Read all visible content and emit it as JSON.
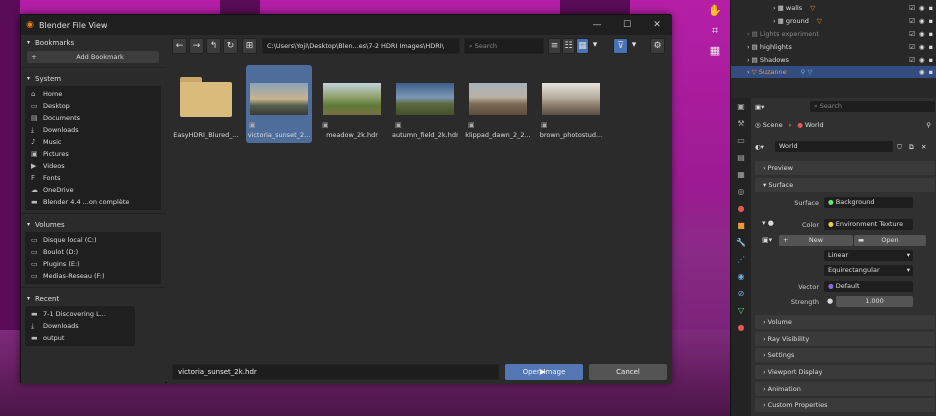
{
  "dialog": {
    "title": "Blender File View",
    "window_buttons": [
      "—",
      "☐",
      "✕"
    ]
  },
  "sidebar": {
    "bookmarks_label": "Bookmarks",
    "add_bookmark_label": "Add Bookmark",
    "system_label": "System",
    "system_items": [
      {
        "label": "Home",
        "icon": "home-icon"
      },
      {
        "label": "Desktop",
        "icon": "desktop-icon"
      },
      {
        "label": "Documents",
        "icon": "documents-icon"
      },
      {
        "label": "Downloads",
        "icon": "downloads-icon"
      },
      {
        "label": "Music",
        "icon": "music-icon"
      },
      {
        "label": "Pictures",
        "icon": "pictures-icon"
      },
      {
        "label": "Videos",
        "icon": "videos-icon"
      },
      {
        "label": "Fonts",
        "icon": "fonts-icon"
      },
      {
        "label": "OneDrive",
        "icon": "onedrive-icon"
      },
      {
        "label": "Blender 4.4 ...on complète",
        "icon": "folder-icon"
      }
    ],
    "volumes_label": "Volumes",
    "volume_items": [
      {
        "label": "Disque local (C:)"
      },
      {
        "label": "Boulot (D:)"
      },
      {
        "label": "Plugins (E:)"
      },
      {
        "label": "Medias-Reseau (F:)"
      }
    ],
    "recent_label": "Recent",
    "recent_items": [
      {
        "label": "7-1 Discovering L..."
      },
      {
        "label": "Downloads"
      },
      {
        "label": "output"
      }
    ]
  },
  "toolbar": {
    "path": "C:\\Users\\Yoji\\Desktop\\Blen...es\\7-2 HDRI Images\\HDRI\\",
    "search_placeholder": "Search"
  },
  "files": [
    {
      "name": "EasyHDRI_Blured_...",
      "type": "folder"
    },
    {
      "name": "victoria_sunset_2...",
      "type": "image",
      "selected": true
    },
    {
      "name": "meadow_2k.hdr",
      "type": "image"
    },
    {
      "name": "autumn_field_2k.hdr",
      "type": "image"
    },
    {
      "name": "klippad_dawn_2_2...",
      "type": "image"
    },
    {
      "name": "brown_photostud...",
      "type": "image"
    }
  ],
  "bottom": {
    "filename": "victoria_sunset_2k.hdr",
    "open_label": "Open Image",
    "cancel_label": "Cancel"
  },
  "outliner": {
    "rows": [
      {
        "label": "walls"
      },
      {
        "label": "ground"
      },
      {
        "label": "Lights experiment"
      },
      {
        "label": "highlights"
      },
      {
        "label": "Shadows"
      },
      {
        "label": "Suzanne"
      }
    ]
  },
  "properties": {
    "search_placeholder": "Search",
    "breadcrumb_scene": "Scene",
    "breadcrumb_world": "World",
    "world_name": "World",
    "sections": {
      "preview": "Preview",
      "surface": "Surface",
      "volume": "Volume",
      "ray_visibility": "Ray Visibility",
      "settings": "Settings",
      "viewport_display": "Viewport Display",
      "animation": "Animation",
      "custom_properties": "Custom Properties"
    },
    "surface_label": "Surface",
    "surface_value": "Background",
    "color_label": "Color",
    "color_value": "Environment Texture",
    "new_label": "New",
    "open_label": "Open",
    "interp_value": "Linear",
    "proj_value": "Equirectangular",
    "vector_label": "Vector",
    "vector_value": "Default",
    "strength_label": "Strength",
    "strength_value": "1.000"
  },
  "colors": {
    "accent": "#5377b5",
    "selection": "#4f6d9a",
    "viewport_bg": "#b51fa7"
  }
}
